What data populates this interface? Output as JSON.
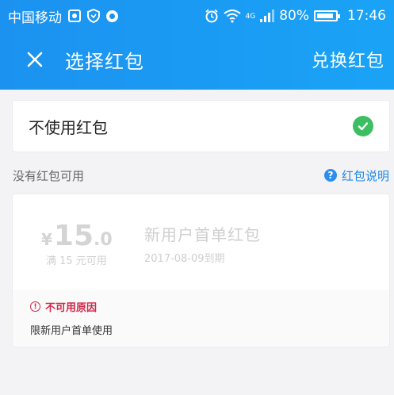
{
  "status_bar": {
    "carrier": "中国移动",
    "network": "4G",
    "battery_percent": "80%",
    "time": "17:46",
    "icons": [
      "gallery-icon",
      "shield-icon",
      "dot-icon",
      "alarm-icon",
      "wifi-icon",
      "signal-icon",
      "battery-icon"
    ]
  },
  "nav": {
    "close_icon": "close-icon",
    "title": "选择红包",
    "action": "兑换红包"
  },
  "no_coupon_option": {
    "label": "不使用红包",
    "selected": true,
    "icon": "check-circle-icon"
  },
  "section": {
    "title": "没有红包可用",
    "help_label": "红包说明",
    "help_icon": "question-icon"
  },
  "coupon": {
    "currency": "¥",
    "amount_int": "15",
    "amount_dec": ".0",
    "condition": "满 15 元可用",
    "name": "新用户首单红包",
    "expiry": "2017-08-09到期",
    "unavailable_title": "不可用原因",
    "unavailable_reason": "限新用户首单使用"
  },
  "colors": {
    "header_blue": "#1b92f0",
    "check_green": "#3cbe63",
    "link_blue": "#1f87ea",
    "warning_red": "#d0284a"
  }
}
